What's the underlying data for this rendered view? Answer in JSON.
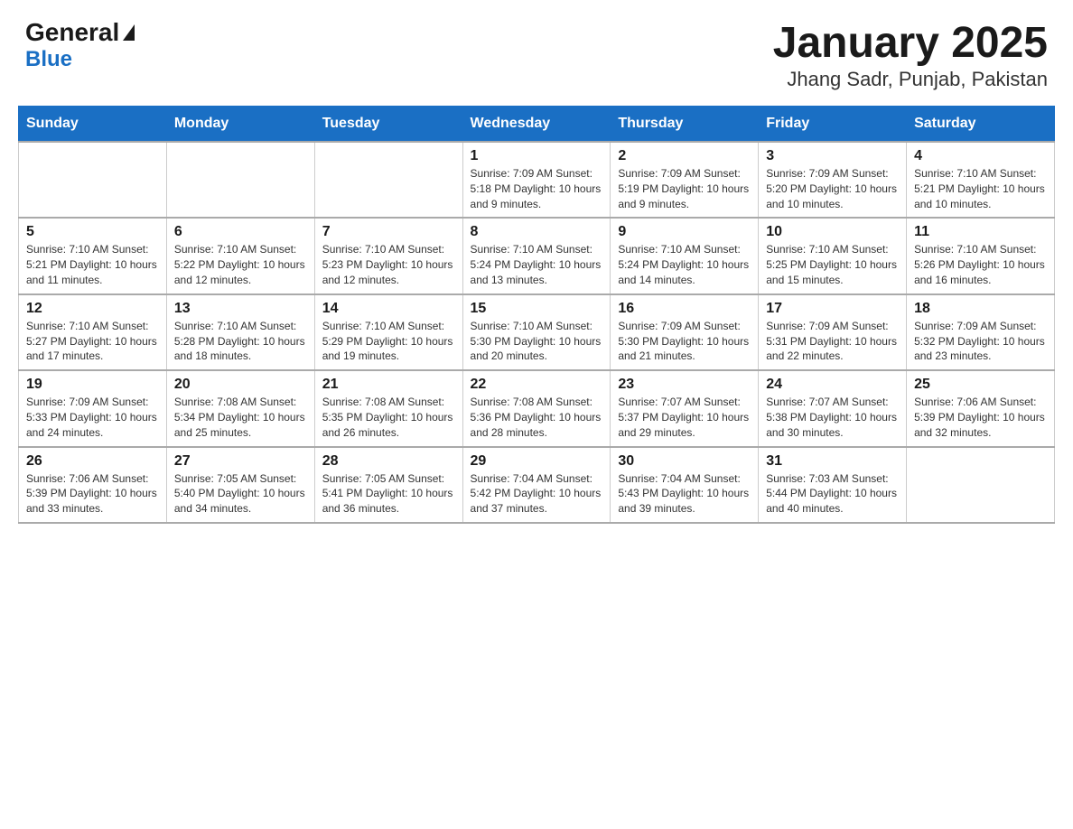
{
  "header": {
    "logo_general": "General",
    "logo_blue": "Blue",
    "title": "January 2025",
    "subtitle": "Jhang Sadr, Punjab, Pakistan"
  },
  "weekdays": [
    "Sunday",
    "Monday",
    "Tuesday",
    "Wednesday",
    "Thursday",
    "Friday",
    "Saturday"
  ],
  "weeks": [
    [
      {
        "day": "",
        "info": ""
      },
      {
        "day": "",
        "info": ""
      },
      {
        "day": "",
        "info": ""
      },
      {
        "day": "1",
        "info": "Sunrise: 7:09 AM\nSunset: 5:18 PM\nDaylight: 10 hours and 9 minutes."
      },
      {
        "day": "2",
        "info": "Sunrise: 7:09 AM\nSunset: 5:19 PM\nDaylight: 10 hours and 9 minutes."
      },
      {
        "day": "3",
        "info": "Sunrise: 7:09 AM\nSunset: 5:20 PM\nDaylight: 10 hours and 10 minutes."
      },
      {
        "day": "4",
        "info": "Sunrise: 7:10 AM\nSunset: 5:21 PM\nDaylight: 10 hours and 10 minutes."
      }
    ],
    [
      {
        "day": "5",
        "info": "Sunrise: 7:10 AM\nSunset: 5:21 PM\nDaylight: 10 hours and 11 minutes."
      },
      {
        "day": "6",
        "info": "Sunrise: 7:10 AM\nSunset: 5:22 PM\nDaylight: 10 hours and 12 minutes."
      },
      {
        "day": "7",
        "info": "Sunrise: 7:10 AM\nSunset: 5:23 PM\nDaylight: 10 hours and 12 minutes."
      },
      {
        "day": "8",
        "info": "Sunrise: 7:10 AM\nSunset: 5:24 PM\nDaylight: 10 hours and 13 minutes."
      },
      {
        "day": "9",
        "info": "Sunrise: 7:10 AM\nSunset: 5:24 PM\nDaylight: 10 hours and 14 minutes."
      },
      {
        "day": "10",
        "info": "Sunrise: 7:10 AM\nSunset: 5:25 PM\nDaylight: 10 hours and 15 minutes."
      },
      {
        "day": "11",
        "info": "Sunrise: 7:10 AM\nSunset: 5:26 PM\nDaylight: 10 hours and 16 minutes."
      }
    ],
    [
      {
        "day": "12",
        "info": "Sunrise: 7:10 AM\nSunset: 5:27 PM\nDaylight: 10 hours and 17 minutes."
      },
      {
        "day": "13",
        "info": "Sunrise: 7:10 AM\nSunset: 5:28 PM\nDaylight: 10 hours and 18 minutes."
      },
      {
        "day": "14",
        "info": "Sunrise: 7:10 AM\nSunset: 5:29 PM\nDaylight: 10 hours and 19 minutes."
      },
      {
        "day": "15",
        "info": "Sunrise: 7:10 AM\nSunset: 5:30 PM\nDaylight: 10 hours and 20 minutes."
      },
      {
        "day": "16",
        "info": "Sunrise: 7:09 AM\nSunset: 5:30 PM\nDaylight: 10 hours and 21 minutes."
      },
      {
        "day": "17",
        "info": "Sunrise: 7:09 AM\nSunset: 5:31 PM\nDaylight: 10 hours and 22 minutes."
      },
      {
        "day": "18",
        "info": "Sunrise: 7:09 AM\nSunset: 5:32 PM\nDaylight: 10 hours and 23 minutes."
      }
    ],
    [
      {
        "day": "19",
        "info": "Sunrise: 7:09 AM\nSunset: 5:33 PM\nDaylight: 10 hours and 24 minutes."
      },
      {
        "day": "20",
        "info": "Sunrise: 7:08 AM\nSunset: 5:34 PM\nDaylight: 10 hours and 25 minutes."
      },
      {
        "day": "21",
        "info": "Sunrise: 7:08 AM\nSunset: 5:35 PM\nDaylight: 10 hours and 26 minutes."
      },
      {
        "day": "22",
        "info": "Sunrise: 7:08 AM\nSunset: 5:36 PM\nDaylight: 10 hours and 28 minutes."
      },
      {
        "day": "23",
        "info": "Sunrise: 7:07 AM\nSunset: 5:37 PM\nDaylight: 10 hours and 29 minutes."
      },
      {
        "day": "24",
        "info": "Sunrise: 7:07 AM\nSunset: 5:38 PM\nDaylight: 10 hours and 30 minutes."
      },
      {
        "day": "25",
        "info": "Sunrise: 7:06 AM\nSunset: 5:39 PM\nDaylight: 10 hours and 32 minutes."
      }
    ],
    [
      {
        "day": "26",
        "info": "Sunrise: 7:06 AM\nSunset: 5:39 PM\nDaylight: 10 hours and 33 minutes."
      },
      {
        "day": "27",
        "info": "Sunrise: 7:05 AM\nSunset: 5:40 PM\nDaylight: 10 hours and 34 minutes."
      },
      {
        "day": "28",
        "info": "Sunrise: 7:05 AM\nSunset: 5:41 PM\nDaylight: 10 hours and 36 minutes."
      },
      {
        "day": "29",
        "info": "Sunrise: 7:04 AM\nSunset: 5:42 PM\nDaylight: 10 hours and 37 minutes."
      },
      {
        "day": "30",
        "info": "Sunrise: 7:04 AM\nSunset: 5:43 PM\nDaylight: 10 hours and 39 minutes."
      },
      {
        "day": "31",
        "info": "Sunrise: 7:03 AM\nSunset: 5:44 PM\nDaylight: 10 hours and 40 minutes."
      },
      {
        "day": "",
        "info": ""
      }
    ]
  ]
}
